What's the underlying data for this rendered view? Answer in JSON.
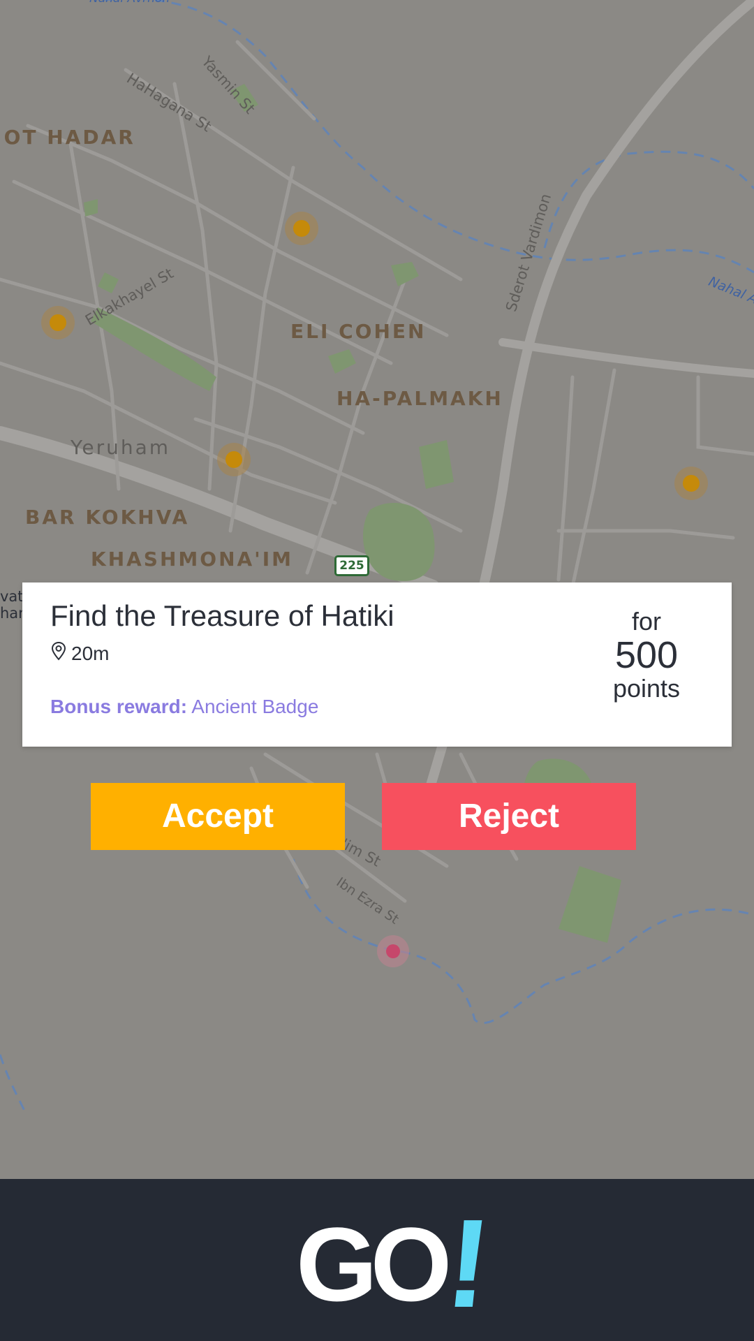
{
  "map": {
    "district_labels": [
      "'OT HADAR",
      "ELI COHEN",
      "HA-PALMAKH",
      "Yeruham",
      "BAR KOKHVA",
      "KHASHMONA'IM"
    ],
    "street_labels": [
      "HaHagana St",
      "Yasmin St",
      "Elkakhayel St",
      "Sderot Vardimon",
      "Ibn Ezra St",
      "'im St"
    ],
    "water_labels": [
      "Nahal Avrhon",
      "Nahal A"
    ],
    "route_number": "225",
    "edge_fragments": [
      "vat",
      "har"
    ],
    "marker_color": "#c58a0a",
    "player_marker_color": "#c6476b"
  },
  "quest": {
    "title": "Find the Treasure of Hatiki",
    "distance": "20m",
    "bonus_label": "Bonus reward:",
    "bonus_value": "Ancient Badge",
    "points_prefix": "for",
    "points_value": "500",
    "points_suffix": "points"
  },
  "actions": {
    "accept_label": "Accept",
    "reject_label": "Reject",
    "accept_color": "#ffb000",
    "reject_color": "#f7505e"
  },
  "brand": {
    "logo_text": "GO",
    "logo_mark": "!",
    "logo_mark_color": "#5ed9f5"
  },
  "icons": {
    "distance": "location-pin-icon"
  }
}
